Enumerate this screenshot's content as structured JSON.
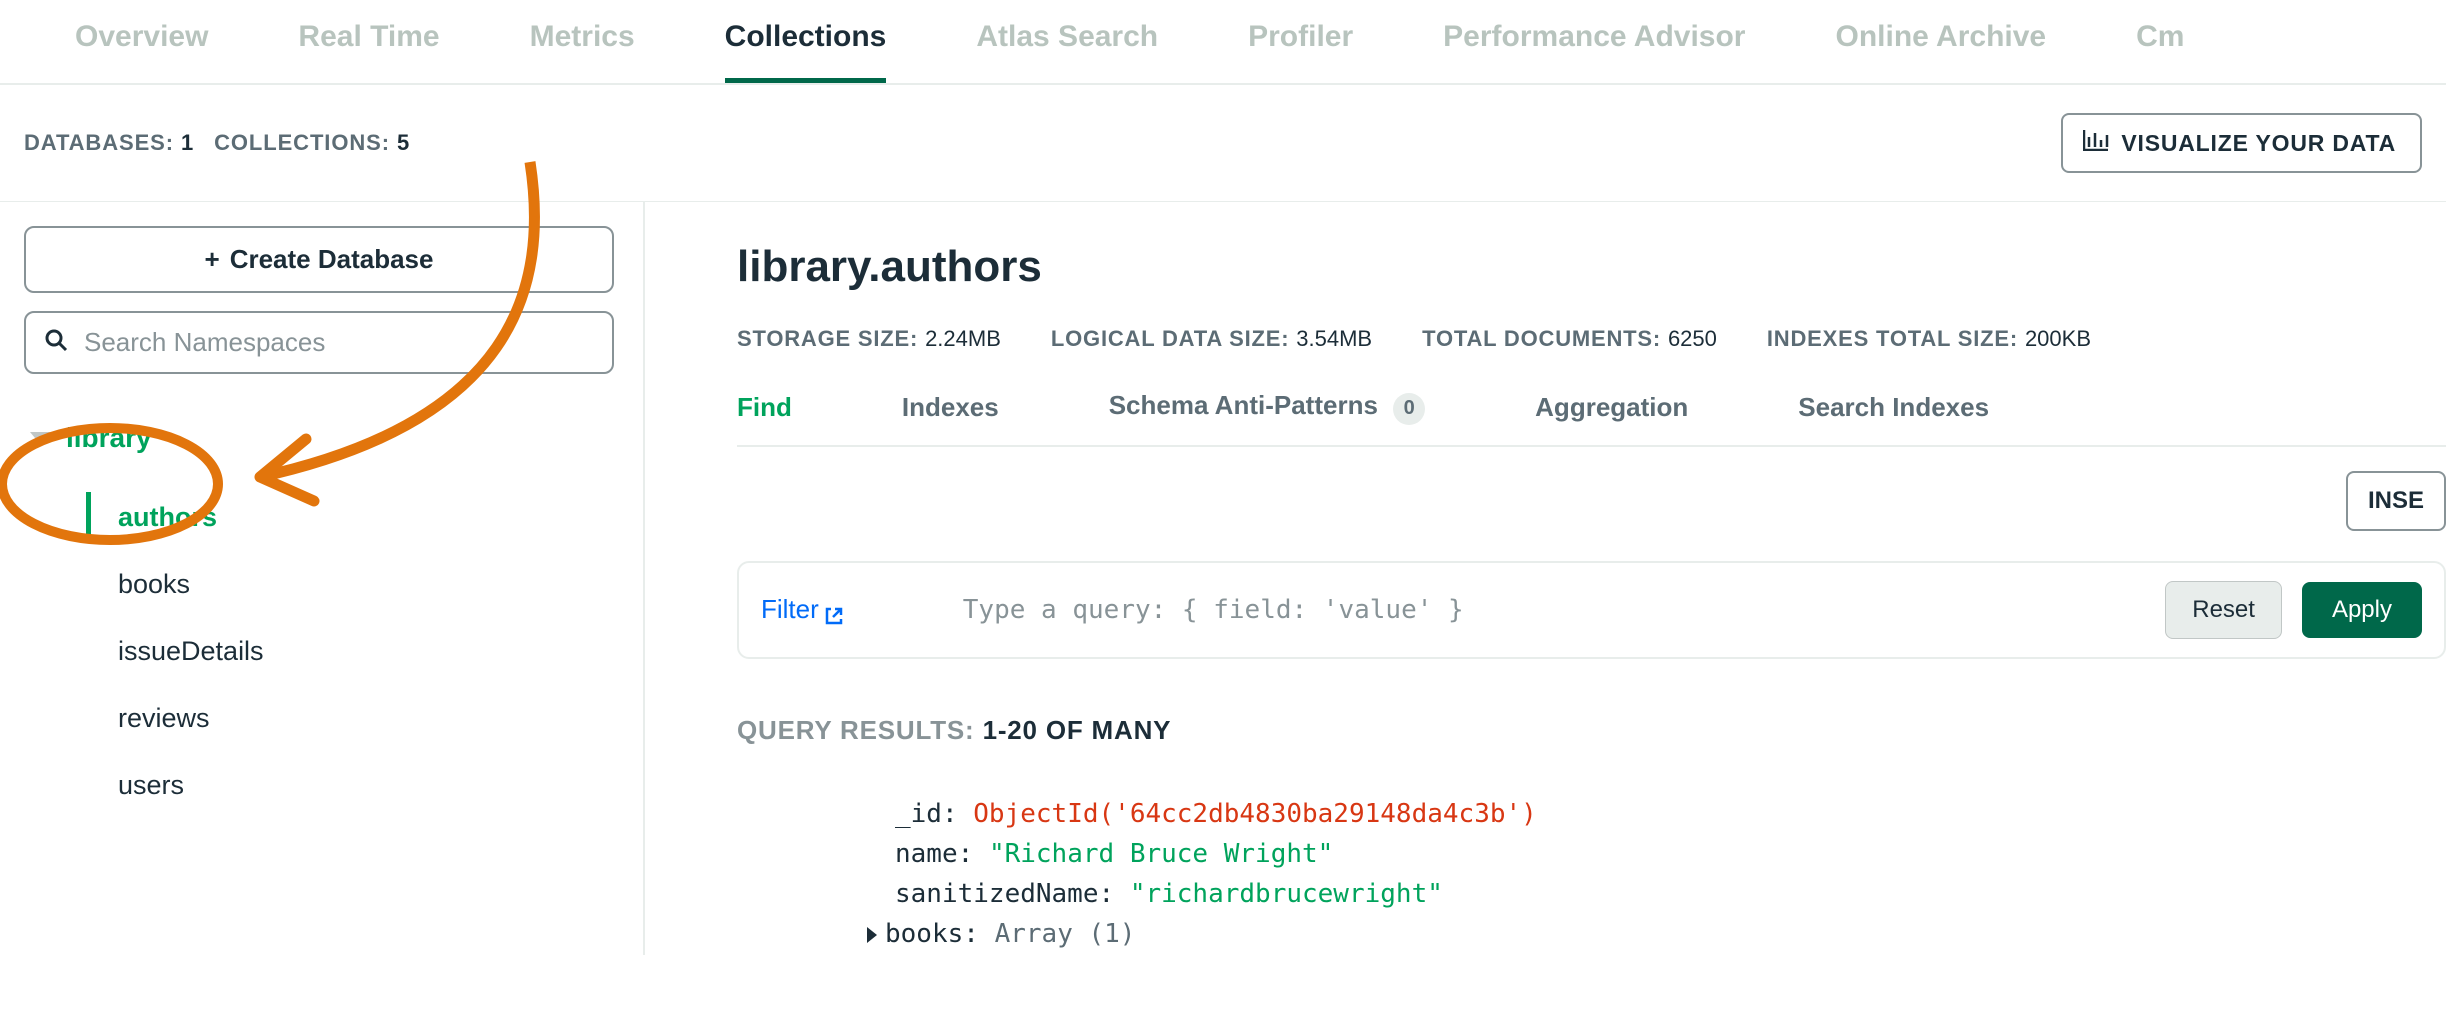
{
  "topTabs": {
    "overview": "Overview",
    "realtime": "Real Time",
    "metrics": "Metrics",
    "collections": "Collections",
    "atlasSearch": "Atlas Search",
    "profiler": "Profiler",
    "perfAdvisor": "Performance Advisor",
    "onlineArchive": "Online Archive",
    "cmd": "Cm"
  },
  "stats": {
    "databasesLabel": "DATABASES:",
    "databasesCount": "1",
    "collectionsLabel": "COLLECTIONS:",
    "collectionsCount": "5",
    "visualizeLabel": "VISUALIZE YOUR DATA"
  },
  "sidebar": {
    "createDb": "Create Database",
    "searchPlaceholder": "Search Namespaces",
    "dbName": "library",
    "collections": {
      "authors": "authors",
      "books": "books",
      "issueDetails": "issueDetails",
      "reviews": "reviews",
      "users": "users"
    }
  },
  "main": {
    "title": "library.authors",
    "storageLabel": "STORAGE SIZE:",
    "storageValue": "2.24MB",
    "logicalLabel": "LOGICAL DATA SIZE:",
    "logicalValue": "3.54MB",
    "totalDocsLabel": "TOTAL DOCUMENTS:",
    "totalDocsValue": "6250",
    "indexesLabel": "INDEXES TOTAL SIZE:",
    "indexesValue": "200KB",
    "tabs": {
      "find": "Find",
      "indexes": "Indexes",
      "schema": "Schema Anti-Patterns",
      "schemaBadge": "0",
      "aggregation": "Aggregation",
      "searchIndexes": "Search Indexes"
    },
    "insertLabel": "INSE",
    "filter": {
      "label": "Filter",
      "placeholder": "Type a query: { field: 'value' }",
      "reset": "Reset",
      "apply": "Apply"
    },
    "results": {
      "label": "QUERY RESULTS:",
      "range": "1-20 OF MANY"
    },
    "doc": {
      "idKey": "_id:",
      "idVal": "ObjectId('64cc2db4830ba29148da4c3b')",
      "nameKey": "name:",
      "nameVal": "\"Richard Bruce Wright\"",
      "sanKey": "sanitizedName:",
      "sanVal": "\"richardbrucewright\"",
      "booksKey": "books:",
      "booksVal": "Array (1)"
    }
  }
}
